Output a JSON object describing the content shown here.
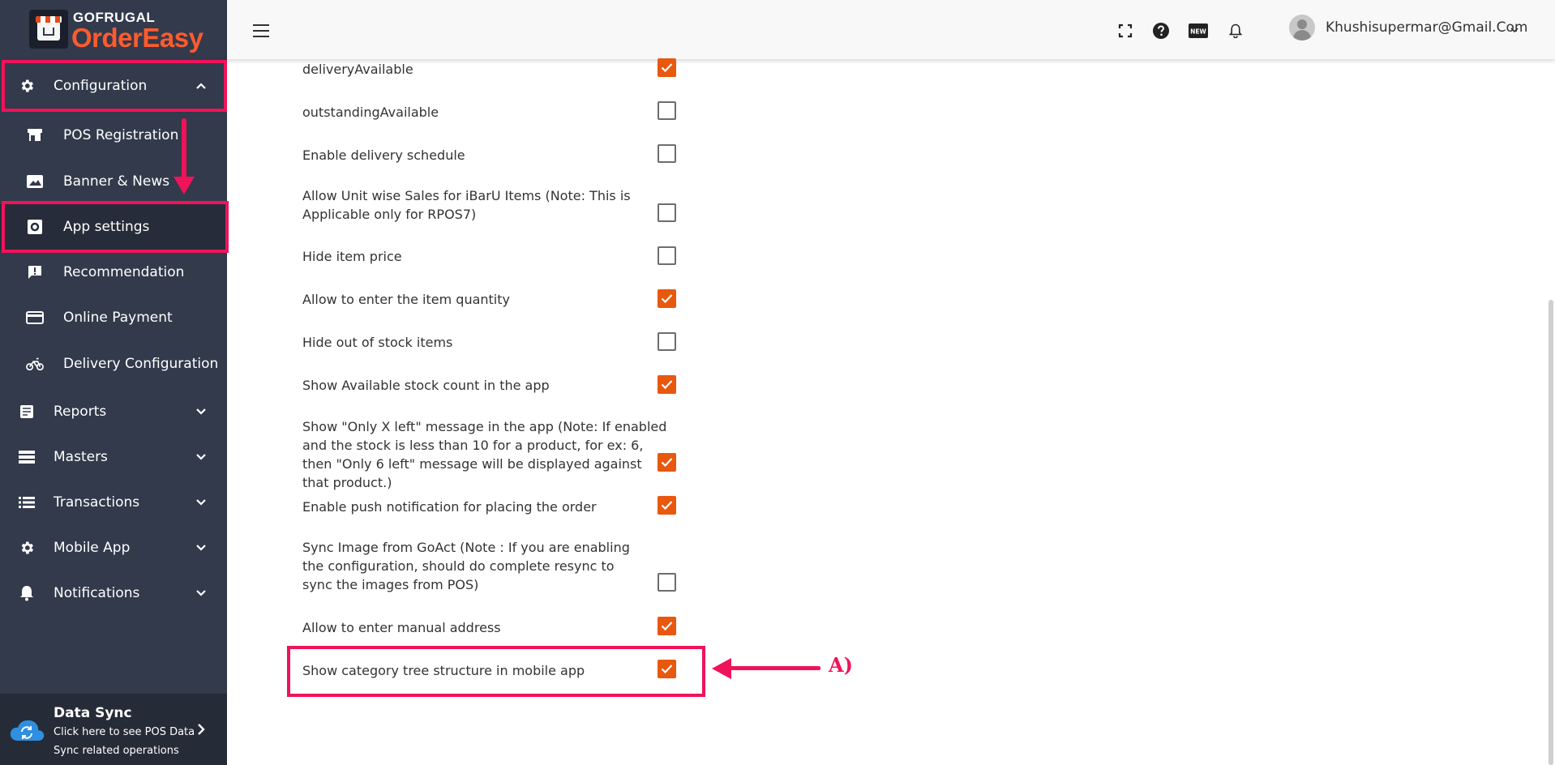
{
  "brand": {
    "top": "GOFRUGAL",
    "bottom": "OrderEasy"
  },
  "sidebar": {
    "configuration": {
      "label": "Configuration"
    },
    "config_items": [
      {
        "label": "POS Registration"
      },
      {
        "label": "Banner & News"
      },
      {
        "label": "App settings"
      },
      {
        "label": "Recommendation"
      },
      {
        "label": "Online Payment"
      },
      {
        "label": "Delivery Configuration"
      }
    ],
    "sections": [
      {
        "label": "Reports"
      },
      {
        "label": "Masters"
      },
      {
        "label": "Transactions"
      },
      {
        "label": "Mobile App"
      },
      {
        "label": "Notifications"
      }
    ],
    "datasync": {
      "title": "Data Sync",
      "line1": "Click here to see POS Data",
      "line2": "Sync related operations"
    }
  },
  "header": {
    "user_email": "Khushisupermar@Gmail.Com",
    "icons": [
      "menu-icon",
      "fullscreen-icon",
      "help-icon",
      "new-icon",
      "bell-icon"
    ]
  },
  "settings": [
    {
      "label": "deliveryAvailable",
      "checked": true
    },
    {
      "label": "outstandingAvailable",
      "checked": false
    },
    {
      "label": "Enable delivery schedule",
      "checked": false
    },
    {
      "label": "Allow Unit wise Sales for iBarU Items (Note: This is Applicable only for RPOS7)",
      "checked": false
    },
    {
      "label": "Hide item price",
      "checked": false
    },
    {
      "label": "Allow to enter the item quantity",
      "checked": true
    },
    {
      "label": "Hide out of stock items",
      "checked": false
    },
    {
      "label": "Show Available stock count in the app",
      "checked": true
    },
    {
      "label": "Show \"Only X left\" message in the app (Note: If enabled and the stock is less than 10 for a product, for ex: 6, then \"Only 6 left\" message will be displayed against that product.)",
      "checked": true
    },
    {
      "label": "Enable push notification for placing the order",
      "checked": true
    },
    {
      "label": "Sync Image from GoAct (Note : If you are enabling the configuration, should do complete resync to sync the images from POS)",
      "checked": false
    },
    {
      "label": "Allow to enter manual address",
      "checked": true
    },
    {
      "label": "Show category tree structure in mobile app",
      "checked": true
    }
  ],
  "annotation": {
    "label": "A)"
  },
  "colors": {
    "accent": "#e8580e",
    "highlight": "#f0135a",
    "sidebar": "#323a4b"
  }
}
